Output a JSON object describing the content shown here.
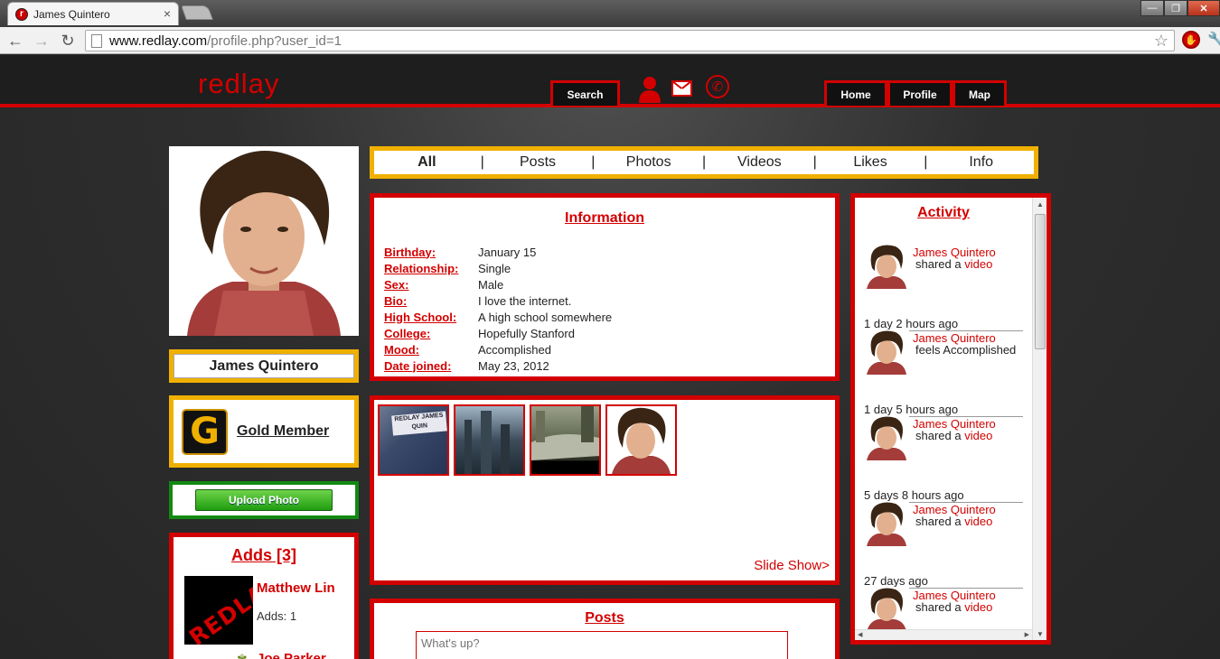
{
  "browser": {
    "tab_title": "James Quintero",
    "favicon_letter": "r",
    "url_host": "www.redlay.com",
    "url_path": "/profile.php?user_id=1"
  },
  "header": {
    "logo": "redlay",
    "search_label": "Search",
    "home_label": "Home",
    "profile_label": "Profile",
    "map_label": "Map"
  },
  "profile": {
    "name": "James Quintero",
    "membership_badge": "G",
    "membership_label": "Gold Member",
    "upload_label": "Upload Photo"
  },
  "adds": {
    "title": "Adds [3]",
    "avatar_text": "REDLAY",
    "items": [
      {
        "name": "Matthew Lin",
        "count": "Adds: 1"
      },
      {
        "name": "Joe Parker"
      }
    ]
  },
  "tabs": {
    "items": [
      "All",
      "Posts",
      "Photos",
      "Videos",
      "Likes",
      "Info"
    ],
    "separator": "|",
    "active": "All"
  },
  "information": {
    "title": "Information",
    "rows": [
      {
        "label": "Birthday:",
        "value": "January 15"
      },
      {
        "label": "Relationship:",
        "value": "Single"
      },
      {
        "label": "Sex:",
        "value": "Male"
      },
      {
        "label": "Bio:",
        "value": "I love the internet."
      },
      {
        "label": "High School:",
        "value": "A high school somewhere"
      },
      {
        "label": "College:",
        "value": "Hopefully Stanford"
      },
      {
        "label": "Mood:",
        "value": "Accomplished"
      },
      {
        "label": "Date joined:",
        "value": "May 23, 2012"
      }
    ]
  },
  "photos": {
    "thumb1_text": "REDLAY JAMES QUIN",
    "slideshow_label": "Slide Show>"
  },
  "posts": {
    "title": "Posts",
    "placeholder": "What's up?"
  },
  "activity": {
    "title": "Activity",
    "items": [
      {
        "name": "James Quintero",
        "action": "shared a",
        "link": "video",
        "time": "1 day 2 hours ago"
      },
      {
        "name": "James Quintero",
        "action": "feels Accomplished",
        "link": "",
        "time": "1 day 5 hours ago"
      },
      {
        "name": "James Quintero",
        "action": "shared a",
        "link": "video",
        "time": "5 days 8 hours ago"
      },
      {
        "name": "James Quintero",
        "action": "shared a",
        "link": "video",
        "time": "27 days ago"
      },
      {
        "name": "James Quintero",
        "action": "shared a",
        "link": "video",
        "time": ""
      }
    ]
  },
  "colors": {
    "brand_red": "#d30000",
    "gold": "#f0b000",
    "green": "#128a12"
  }
}
